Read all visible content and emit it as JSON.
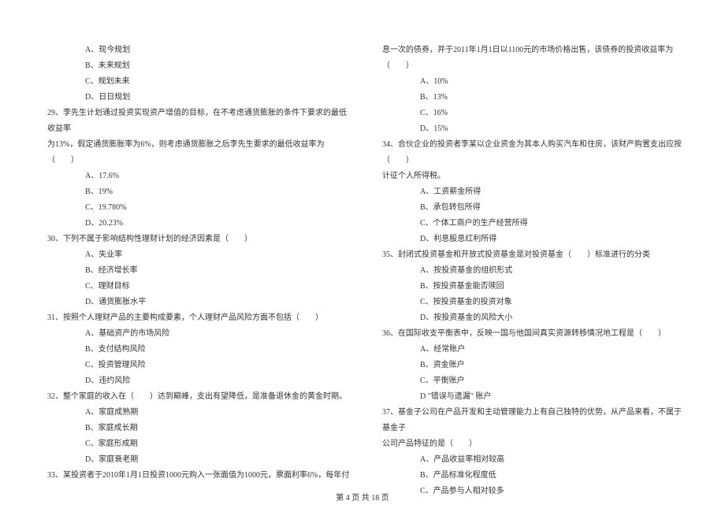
{
  "left_column": {
    "q28_opts": [
      "A、现今规划",
      "B、未来规划",
      "C、规划未来",
      "D、日日规划"
    ],
    "q29_line1": "29、李先生计划通过投资实现资产增值的目标，在不考虑通货膨胀的条件下要求的最低收益率",
    "q29_line2": "为13%，假定通货膨胀率为6%，则考虑通货膨胀之后李先生要求的最低收益率为（　　）",
    "q29_opts": [
      "A、17.6%",
      "B、19%",
      "C、19.780%",
      "D、20.23%"
    ],
    "q30_line": "30、下列不属于影响结构性理财计划的经济因素是（　　）",
    "q30_opts": [
      "A、失业率",
      "B、经济增长率",
      "C、理财目标",
      "D、通货膨胀水平"
    ],
    "q31_line": "31、按照个人理财产品的主要构成要素，个人理财产品风险方面不包括（　　）",
    "q31_opts": [
      "A、基础资产的市场风险",
      "B、支付结构风险",
      "C、投资管理风险",
      "D、违约风险"
    ],
    "q32_line": "32、整个家庭的收入在（　　）达到巅峰，支出有望降低，是准备退休金的黄金时期。",
    "q32_opts": [
      "A、家庭成熟期",
      "B、家庭成长期",
      "C、家庭形成期",
      "D、家庭衰老期"
    ],
    "q33_line": "33、某投资者于2010年1月1日投资1000元购入一张面值为1000元，票面利率6%，每年付"
  },
  "right_column": {
    "q33_cont": "息一次的债券，并于2011年1月1日以1100元的市场价格出售，该债券的投资收益率为（　　）",
    "q33_opts": [
      "A、10%",
      "B、13%",
      "C、16%",
      "D、15%"
    ],
    "q34_line1": "34、合伙企业的投资者李某以企业资金为其本人购买汽车和住房，该财产购置支出应按（　　）",
    "q34_line2": "计征个人所得税。",
    "q34_opts": [
      "A、工资薪金所得",
      "B、承包转包所得",
      "C、个体工商户的生产经营所得",
      "D、利息股息红利所得"
    ],
    "q35_line": "35、封闭式投资基金和开放式投资基金是对投资基金（　　）标准进行的分类",
    "q35_opts": [
      "A、按投资基金的组织形式",
      "B、按投资基金能否赎回",
      "C、按投资基金的投资对象",
      "D、按投资基金的风险大小"
    ],
    "q36_line": "36、在国际收支平衡表中，反映一国与他国间真实资源转移情况地工程是（　　）",
    "q36_opts": [
      "A、经常账户",
      "B、资金账户",
      "C、平衡账户",
      "D \"错误与遗漏\" 账户"
    ],
    "q37_line1": "37、基金子公司在产品开发和主动管理能力上有自己独特的优势，从产品来看，不属于基金子",
    "q37_line2": "公司产品特征的是（　　）",
    "q37_opts": [
      "A、产品收益率相对较高",
      "B、产品标准化程度低",
      "C、产品参与人相对较多"
    ]
  },
  "footer": "第 4 页 共 18 页"
}
